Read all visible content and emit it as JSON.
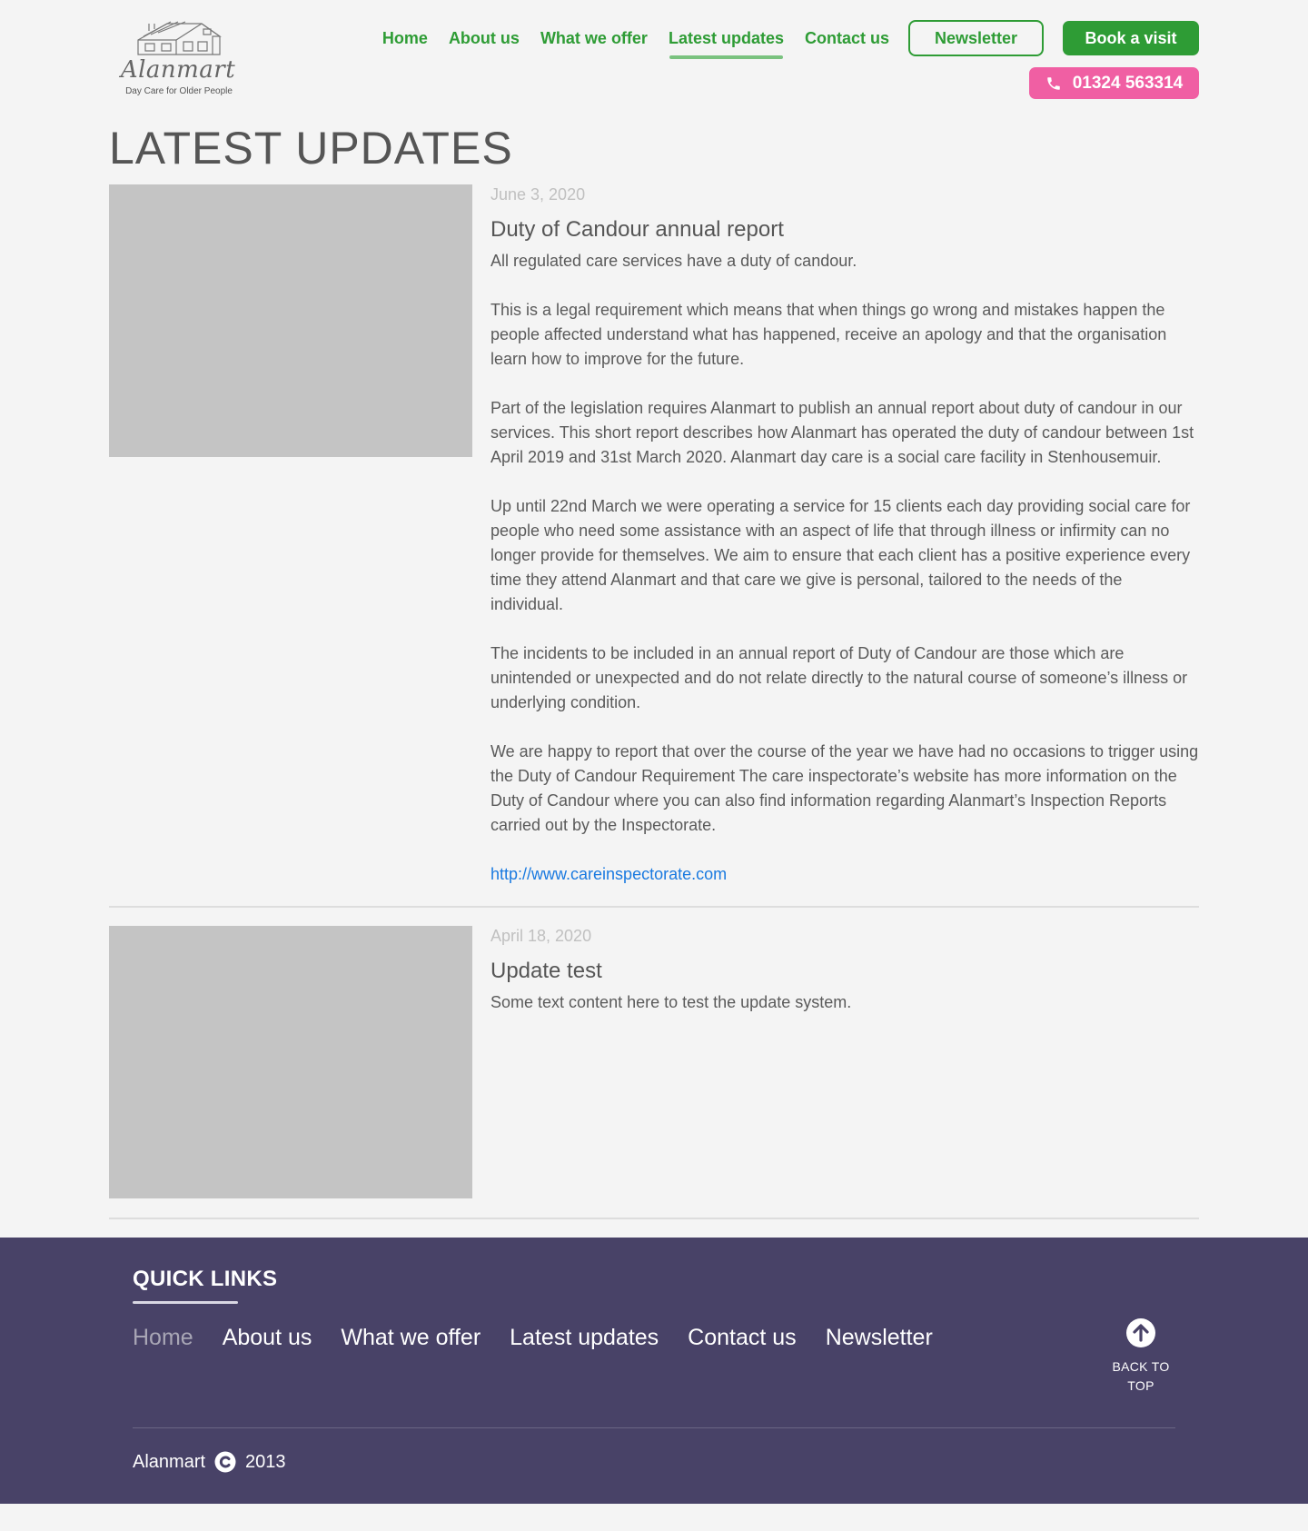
{
  "brand": {
    "name": "Alanmart",
    "tagline": "Day Care for Older People"
  },
  "nav": {
    "items": [
      {
        "label": "Home"
      },
      {
        "label": "About us"
      },
      {
        "label": "What we offer"
      },
      {
        "label": "Latest updates",
        "active": true
      },
      {
        "label": "Contact us"
      }
    ],
    "newsletter_label": "Newsletter",
    "book_label": "Book a visit",
    "phone": "01324 563314"
  },
  "page": {
    "title": "LATEST UPDATES"
  },
  "posts": [
    {
      "date": "June 3, 2020",
      "title": "Duty of Candour annual report",
      "paragraphs": [
        "All regulated care services have a duty of candour.",
        "This is a legal requirement which means that when things go wrong and mistakes happen the people affected understand what has happened, receive an apology and that the organisation learn how to improve for the future.",
        "Part of the legislation requires Alanmart to publish an annual report about duty of candour in our services. This short report describes how Alanmart has operated the duty of candour between 1st April 2019 and 31st March 2020. Alanmart day care is a social care facility in Stenhousemuir.",
        "Up until 22nd March we were operating a service for 15 clients each day providing social care for people who need some assistance with an aspect of life that through illness or infirmity can no longer provide for themselves. We aim to ensure that each client has a positive experience every time they attend Alanmart and that care we give is personal, tailored to the needs of the individual.",
        "The incidents to be included in an annual report of Duty of Candour are those which are unintended or unexpected and do not relate directly to the natural course of someone’s illness or underlying condition.",
        "We are happy to report that over the course of the year we have had no occasions to trigger using the Duty of Candour Requirement The care inspectorate’s website has more information on the Duty of Candour where you can also find information regarding Alanmart’s Inspection Reports carried out by the Inspectorate."
      ],
      "link": "http://www.careinspectorate.com"
    },
    {
      "date": "April 18, 2020",
      "title": "Update test",
      "paragraphs": [
        "Some text content here to test the update system."
      ]
    }
  ],
  "footer": {
    "heading": "QUICK LINKS",
    "links": [
      "Home",
      "About us",
      "What we offer",
      "Latest updates",
      "Contact us",
      "Newsletter"
    ],
    "back_to_top": "BACK TO TOP",
    "copyright_name": "Alanmart",
    "copyright_year": "2013"
  },
  "colors": {
    "background": "#f4f4f4",
    "brand_green": "#2e9c35",
    "phone_pink": "#f05fa3",
    "footer_purple": "#484267",
    "link_blue": "#1a7ae0",
    "image_placeholder": "#c4c4c4"
  },
  "icons": {
    "phone": "phone-icon",
    "back_to_top": "arrow-up-circle-icon",
    "copyright": "copyright-icon",
    "logo": "house-logo-icon"
  }
}
